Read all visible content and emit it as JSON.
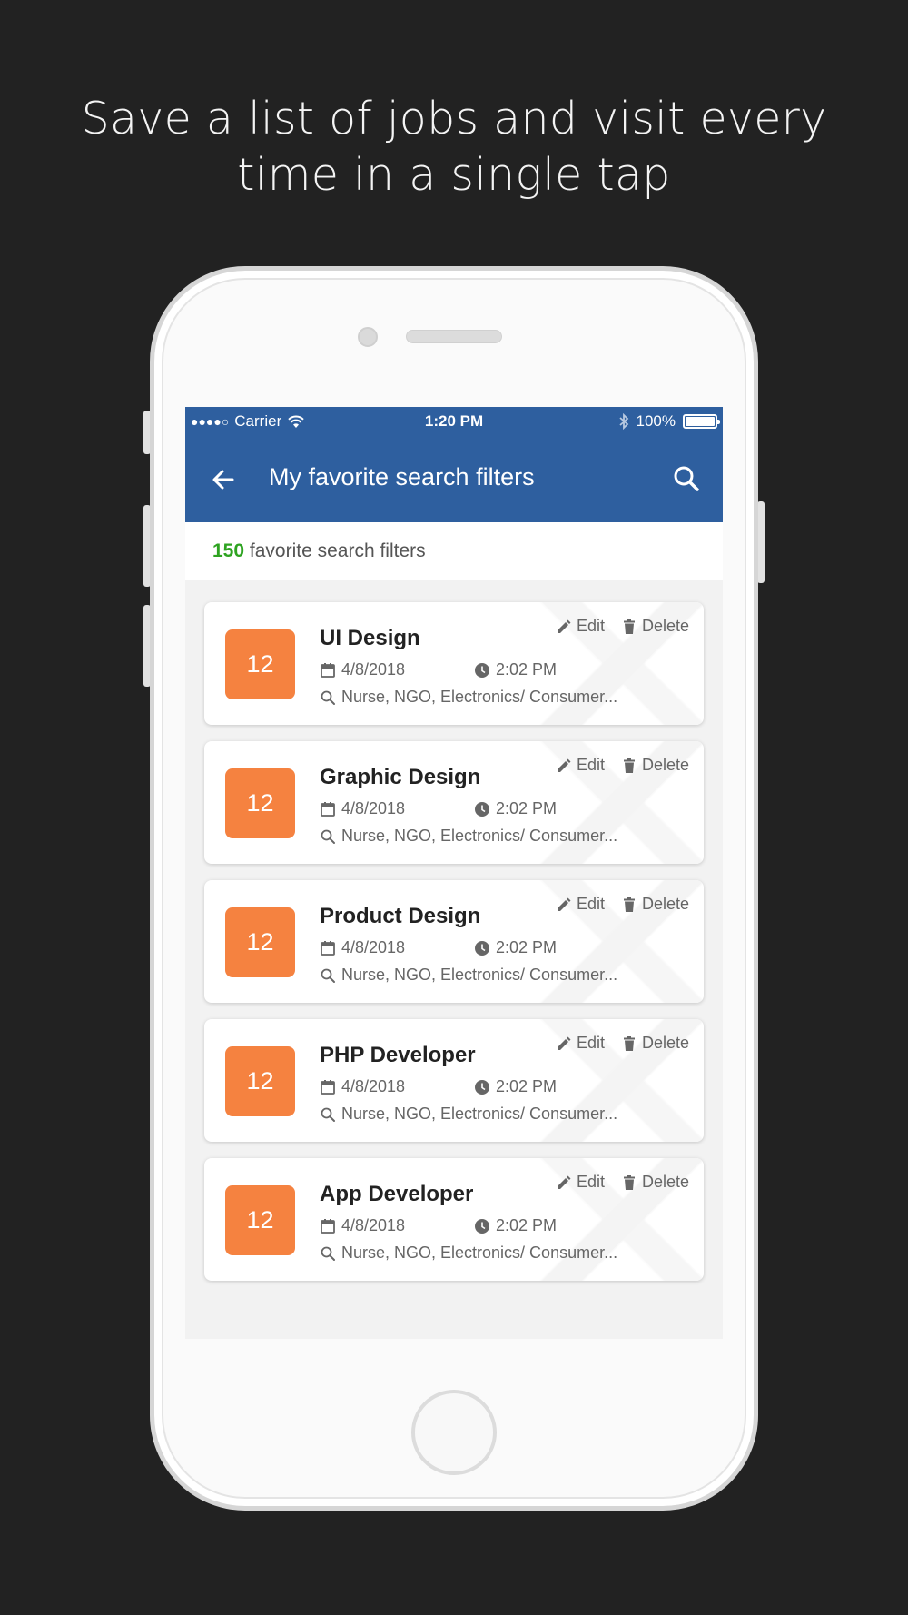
{
  "headline": {
    "line1": "Save a list of jobs and visit every",
    "line2": "time in a single tap"
  },
  "status_bar": {
    "signal": "●●●●○",
    "carrier": "Carrier",
    "time": "1:20 PM",
    "battery": "100%",
    "battery_level": 1.0
  },
  "app_bar": {
    "title": "My favorite search filters",
    "back_icon": "arrow-left-icon",
    "search_icon": "search-icon",
    "color": "#2e5f9f"
  },
  "summary": {
    "count": "150",
    "label": "favorite search filters",
    "count_color": "#2ea321"
  },
  "actions": {
    "edit": "Edit",
    "delete": "Delete"
  },
  "badge_color": "#f58240",
  "cards": [
    {
      "count": "12",
      "title": "UI Design",
      "date": "4/8/2018",
      "time": "2:02 PM",
      "tags": "Nurse, NGO, Electronics/ Consumer..."
    },
    {
      "count": "12",
      "title": "Graphic Design",
      "date": "4/8/2018",
      "time": "2:02 PM",
      "tags": "Nurse, NGO, Electronics/ Consumer..."
    },
    {
      "count": "12",
      "title": "Product Design",
      "date": "4/8/2018",
      "time": "2:02 PM",
      "tags": "Nurse, NGO, Electronics/ Consumer..."
    },
    {
      "count": "12",
      "title": "PHP Developer",
      "date": "4/8/2018",
      "time": "2:02 PM",
      "tags": "Nurse, NGO, Electronics/ Consumer..."
    },
    {
      "count": "12",
      "title": "App Developer",
      "date": "4/8/2018",
      "time": "2:02 PM",
      "tags": "Nurse, NGO, Electronics/ Consumer..."
    }
  ]
}
